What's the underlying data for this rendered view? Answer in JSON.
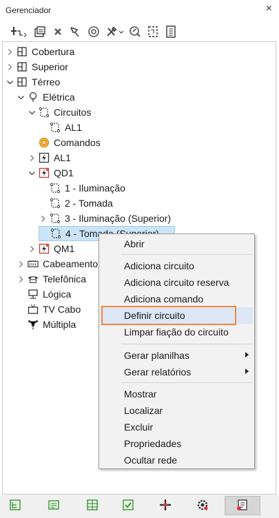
{
  "window": {
    "title": "Gerenciador",
    "close_label": "×"
  },
  "toolbar": {
    "buttons": [
      {
        "icon": "add-tree-icon"
      },
      {
        "icon": "layers-icon"
      },
      {
        "icon": "delete-x-icon"
      },
      {
        "icon": "filter-icon"
      },
      {
        "icon": "target-icon"
      },
      {
        "icon": "tools-icon"
      },
      {
        "icon": "zoom-icon"
      },
      {
        "icon": "diagram-icon"
      },
      {
        "icon": "document-icon"
      }
    ]
  },
  "tree": {
    "nodes": [
      {
        "label": "Cobertura",
        "icon": "floor-plan-icon",
        "expander": "collapsed"
      },
      {
        "label": "Superior",
        "icon": "floor-plan-icon",
        "expander": "collapsed"
      },
      {
        "label": "Térreo",
        "icon": "floor-plan-icon",
        "expander": "expanded"
      },
      {
        "label": "Elétrica",
        "icon": "lightbulb-icon",
        "expander": "expanded"
      },
      {
        "label": "Circuitos",
        "icon": "circuit-icon",
        "expander": "expanded"
      },
      {
        "label": "AL1",
        "icon": "circuit-icon",
        "expander": "none"
      },
      {
        "label": "Comandos",
        "icon": "command-icon",
        "expander": "none"
      },
      {
        "label": "AL1",
        "icon": "panel-icon",
        "expander": "collapsed"
      },
      {
        "label": "QD1",
        "icon": "panel-red-icon",
        "expander": "expanded"
      },
      {
        "label": "1 - Iluminação",
        "icon": "circuit-icon",
        "expander": "none"
      },
      {
        "label": "2 - Tomada",
        "icon": "circuit-icon",
        "expander": "none"
      },
      {
        "label": "3 - Iluminação (Superior)",
        "icon": "circuit-icon",
        "expander": "collapsed"
      },
      {
        "label": "4 - Tomada (Superior)",
        "icon": "circuit-icon",
        "expander": "none",
        "selected": true
      },
      {
        "label": "QM1",
        "icon": "panel-red-icon",
        "expander": "collapsed"
      },
      {
        "label": "Cabeamento",
        "icon": "cabling-icon",
        "expander": "collapsed"
      },
      {
        "label": "Telefônica",
        "icon": "telephone-icon",
        "expander": "collapsed"
      },
      {
        "label": "Lógica",
        "icon": "network-icon",
        "expander": "none"
      },
      {
        "label": "TV Cabo",
        "icon": "tv-icon",
        "expander": "none"
      },
      {
        "label": "Múltipla",
        "icon": "multiple-icon",
        "expander": "none"
      }
    ]
  },
  "context_menu": {
    "items": [
      {
        "label": "Abrir"
      },
      {
        "label": "Adiciona circuito"
      },
      {
        "label": "Adiciona circuito reserva"
      },
      {
        "label": "Adiciona comando"
      },
      {
        "label": "Definir circuito",
        "highlighted": true
      },
      {
        "label": "Limpar fiação do circuito"
      },
      {
        "label": "Gerar planilhas",
        "submenu": true
      },
      {
        "label": "Gerar relatórios",
        "submenu": true
      },
      {
        "label": "Mostrar"
      },
      {
        "label": "Localizar"
      },
      {
        "label": "Excluir"
      },
      {
        "label": "Propriedades"
      },
      {
        "label": "Ocultar rede"
      }
    ]
  },
  "bottom_tabs": [
    {
      "icon": "tree-tab-icon"
    },
    {
      "icon": "list-tab-icon"
    },
    {
      "icon": "grid-tab-icon"
    },
    {
      "icon": "check-tab-icon"
    },
    {
      "icon": "move-tab-icon"
    },
    {
      "icon": "settings-tab-icon"
    },
    {
      "icon": "properties-tab-icon",
      "active": true
    }
  ],
  "colors": {
    "selection": "#cce4f7",
    "highlight_border": "#f0883a",
    "menu_bg": "#f2f2f2"
  }
}
